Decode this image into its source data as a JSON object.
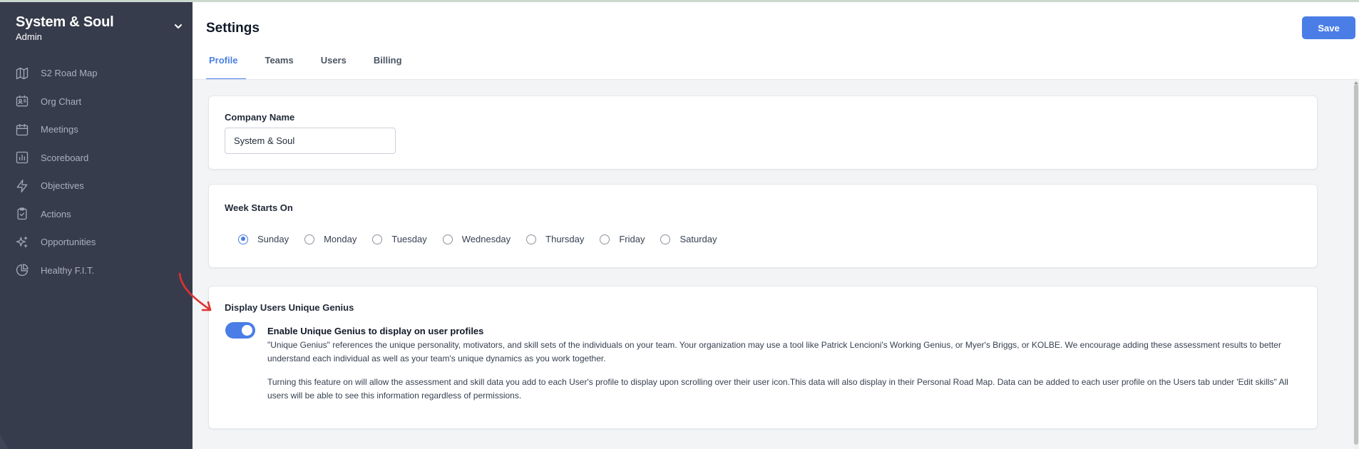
{
  "sidebar": {
    "brand": "System & Soul",
    "role": "Admin",
    "items": [
      {
        "label": "S2 Road Map",
        "icon": "map-icon"
      },
      {
        "label": "Org Chart",
        "icon": "contact-card-icon"
      },
      {
        "label": "Meetings",
        "icon": "calendar-icon"
      },
      {
        "label": "Scoreboard",
        "icon": "bar-chart-icon"
      },
      {
        "label": "Objectives",
        "icon": "lightning-icon"
      },
      {
        "label": "Actions",
        "icon": "clipboard-check-icon"
      },
      {
        "label": "Opportunities",
        "icon": "sparkles-icon"
      },
      {
        "label": "Healthy F.I.T.",
        "icon": "pie-chart-icon"
      }
    ]
  },
  "header": {
    "title": "Settings",
    "save_label": "Save"
  },
  "tabs": [
    {
      "label": "Profile",
      "active": true
    },
    {
      "label": "Teams",
      "active": false
    },
    {
      "label": "Users",
      "active": false
    },
    {
      "label": "Billing",
      "active": false
    }
  ],
  "company": {
    "label": "Company Name",
    "value": "System & Soul"
  },
  "week": {
    "label": "Week Starts On",
    "selected": "Sunday",
    "options": [
      "Sunday",
      "Monday",
      "Tuesday",
      "Wednesday",
      "Thursday",
      "Friday",
      "Saturday"
    ]
  },
  "genius": {
    "section_label": "Display Users Unique Genius",
    "toggle_on": true,
    "toggle_title": "Enable Unique Genius to display on user profiles",
    "paragraph1": "\"Unique Genius\" references the unique personality, motivators, and skill sets of the individuals on your team. Your organization may use a tool like Patrick Lencioni's Working Genius, or Myer's Briggs, or KOLBE. We encourage adding these assessment results to better understand each individual as well as your team's unique dynamics as you work together.",
    "paragraph2": "Turning this feature on will allow the assessment and skill data you add to each User's profile to display upon scrolling over their user icon.This data will also display in their Personal Road Map. Data can be added to each user profile on the Users tab under 'Edit skills\" All users will be able to see this information regardless of permissions."
  },
  "colors": {
    "accent": "#4a7ee6",
    "sidebar_bg": "#373c4c",
    "annotation": "#e03131"
  }
}
